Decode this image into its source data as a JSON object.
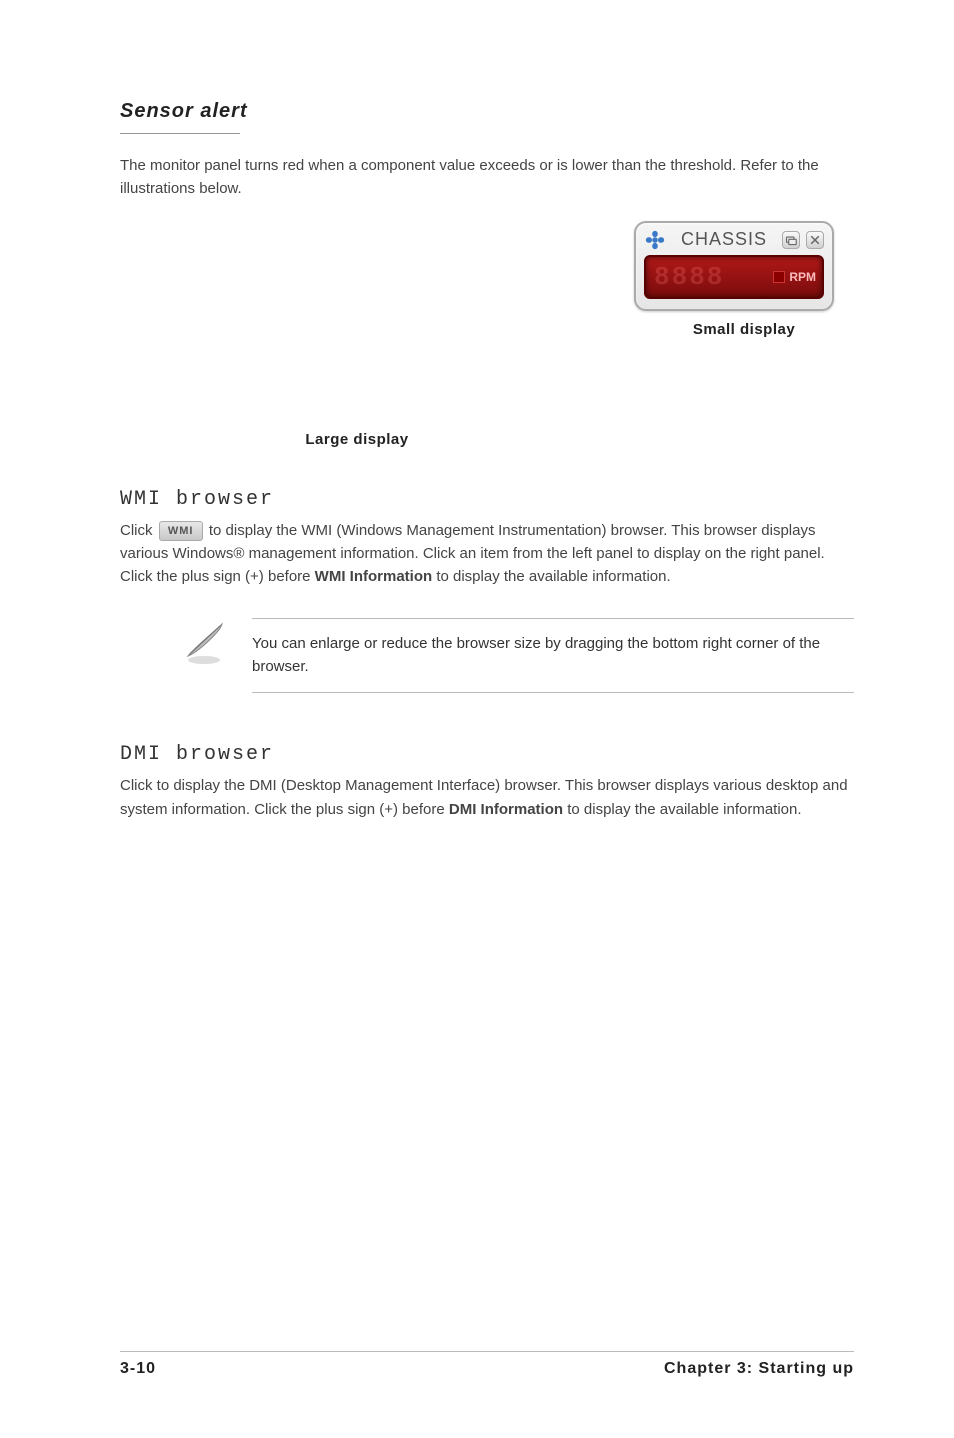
{
  "monitor": {
    "title": "Sensor alert",
    "body1": "The monitor panel turns red when a component value exceeds or is lower than the threshold. Refer to the illustrations below.",
    "small_caption": "Small display",
    "large_caption": "Large display",
    "widget": {
      "label": "CHASSIS",
      "digits": "8888",
      "unit": "RPM"
    }
  },
  "wmi": {
    "title": "WMI browser",
    "btn": "WMI",
    "body_pre": "Click ",
    "body_mid": " to display the WMI (Windows Management Instrumentation) browser. This browser displays various Windows® management information. Click an item from the left panel to display on the right panel. Click the plus sign (+) before ",
    "bold": "WMI Information",
    "body_post": " to display the available information.",
    "note": "You can enlarge or reduce the browser size by dragging the bottom right corner of the browser."
  },
  "dmi": {
    "title": "DMI browser",
    "body_pre": "Click  to display the DMI (Desktop Management Interface) browser. This browser displays various desktop and system information. Click the plus sign (+) before ",
    "bold": "DMI Information",
    "body_post": " to display the available information."
  },
  "footer": {
    "left": "3-10",
    "right": "Chapter 3: Starting up"
  }
}
